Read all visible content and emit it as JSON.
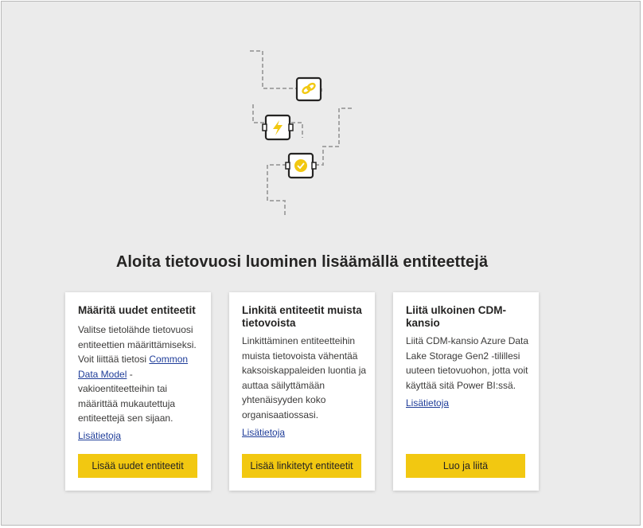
{
  "headline": "Aloita tietovuosi luominen lisäämällä entiteettejä",
  "illustration_icons": [
    "link-icon",
    "lightning-icon",
    "badge-check-icon"
  ],
  "colors": {
    "accent": "#f2c811",
    "link": "#1f3d99",
    "background": "#ebebeb"
  },
  "cards": [
    {
      "title": "Määritä uudet entiteetit",
      "desc_before": "Valitse tietolähde tietovuosi entiteettien määrittämiseksi. Voit liittää tietosi ",
      "desc_link": "Common Data Model",
      "desc_after": " -vakioentiteetteihin tai määrittää mukautettuja entiteettejä sen sijaan.",
      "more": "Lisätietoja",
      "button": "Lisää uudet entiteetit"
    },
    {
      "title": "Linkitä entiteetit muista tietovoista",
      "desc": "Linkittäminen entiteetteihin muista tietovoista vähentää kaksoiskappaleiden luontia ja auttaa säilyttämään yhtenäisyyden koko organisaatiossasi.",
      "more": "Lisätietoja",
      "button": "Lisää linkitetyt entiteetit"
    },
    {
      "title": "Liitä ulkoinen CDM-kansio",
      "desc": "Liitä CDM-kansio Azure Data Lake Storage Gen2 -tilillesi uuteen tietovuohon, jotta voit käyttää sitä Power BI:ssä.",
      "more": "Lisätietoja",
      "button": "Luo ja liitä"
    }
  ]
}
